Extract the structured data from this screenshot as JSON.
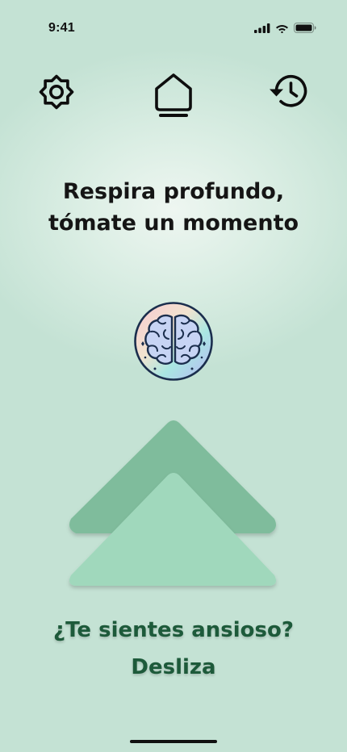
{
  "status_bar": {
    "time": "9:41",
    "icons": [
      "cellular-signal-icon",
      "wifi-icon",
      "battery-icon"
    ]
  },
  "nav": {
    "settings_icon": "gear-icon",
    "home_icon": "home-icon",
    "history_icon": "history-icon",
    "active": "home"
  },
  "headline": {
    "line1": "Respira profundo,",
    "line2": "tómate un momento"
  },
  "illustration": {
    "icon": "brain-icon"
  },
  "swipe": {
    "icon": "double-chevron-up-icon",
    "colors": {
      "back": "#7fbc9c",
      "front": "#a0d8bc"
    }
  },
  "cta": {
    "line1": "¿Te sientes ansioso?",
    "line2": "Desliza"
  },
  "colors": {
    "background": "#c4e2d4",
    "accent": "#1d5a3a"
  }
}
